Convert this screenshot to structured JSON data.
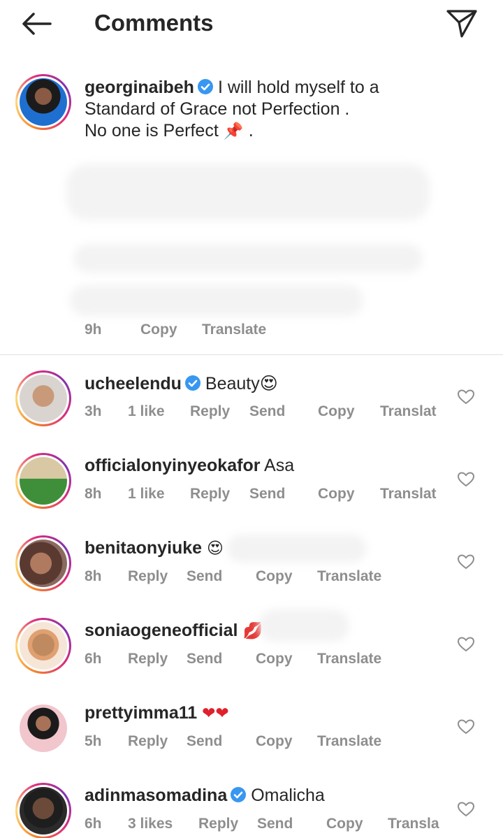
{
  "header": {
    "title": "Comments"
  },
  "caption": {
    "username": "georginaibeh",
    "text_line1": "I will hold myself to a",
    "text_line2": "Standard of Grace not Perfection .",
    "text_line3": "No one is Perfect",
    "text_line3_end": "📌 .",
    "time": "9h",
    "copy": "Copy",
    "translate": "Translate"
  },
  "comments": [
    {
      "username": "ucheelendu",
      "verified": true,
      "text": "Beauty😍",
      "time": "3h",
      "likes": "1 like",
      "reply": "Reply",
      "send": "Send",
      "copy": "Copy",
      "translate": "Translat"
    },
    {
      "username": "officialonyinyeokafor",
      "verified": false,
      "text": "Asa",
      "time": "8h",
      "likes": "1 like",
      "reply": "Reply",
      "send": "Send",
      "copy": "Copy",
      "translate": "Translat"
    },
    {
      "username": "benitaonyiuke",
      "verified": false,
      "text": "😍",
      "time": "8h",
      "reply": "Reply",
      "send": "Send",
      "copy": "Copy",
      "translate": "Translate"
    },
    {
      "username": "soniaogeneofficial",
      "verified": false,
      "text": "💋",
      "time": "6h",
      "reply": "Reply",
      "send": "Send",
      "copy": "Copy",
      "translate": "Translate"
    },
    {
      "username": "prettyimma11",
      "verified": false,
      "text": "❤❤",
      "time": "5h",
      "reply": "Reply",
      "send": "Send",
      "copy": "Copy",
      "translate": "Translate"
    },
    {
      "username": "adinmasomadina",
      "verified": true,
      "text": "Omalicha",
      "time": "6h",
      "likes": "3 likes",
      "reply": "Reply",
      "send": "Send",
      "copy": "Copy",
      "translate": "Transla"
    }
  ],
  "icons": {
    "back": "arrow-left-icon",
    "send": "paper-plane-icon",
    "verified": "verified-badge-icon",
    "like": "heart-outline-icon"
  },
  "colors": {
    "verified": "#3897f0",
    "meta": "#8e8e8e",
    "text": "#262626"
  }
}
